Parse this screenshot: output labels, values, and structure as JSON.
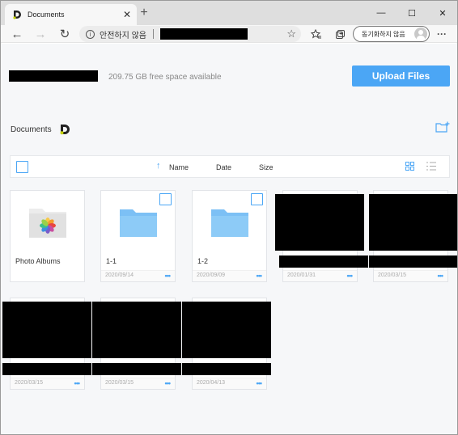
{
  "browser": {
    "tab_title": "Documents",
    "tab_close": "✕",
    "new_tab": "+",
    "security_label": "안전하지 않음",
    "sync_label": "동기화하지 않음",
    "more_label": "···",
    "minimize": "—",
    "maximize": "☐",
    "close": "✕"
  },
  "page": {
    "storage_free": "209.75 GB free space available",
    "upload_button": "Upload Files",
    "breadcrumb": "Documents",
    "accent_color": "#4ba6f5"
  },
  "toolbar": {
    "columns": {
      "name": "Name",
      "date": "Date",
      "size": "Size"
    },
    "sort_indicator": "↑"
  },
  "items": [
    {
      "name": "Photo Albums",
      "date": "",
      "type": "photo-albums"
    },
    {
      "name": "1-1",
      "date": "2020/09/14",
      "type": "folder"
    },
    {
      "name": "1-2",
      "date": "2020/09/09",
      "type": "folder"
    },
    {
      "name": "",
      "date": "2020/01/31",
      "type": "redacted"
    },
    {
      "name": "",
      "date": "2020/03/15",
      "type": "redacted"
    },
    {
      "name": "",
      "date": "2020/03/15",
      "type": "redacted"
    },
    {
      "name": "",
      "date": "2020/03/15",
      "type": "redacted"
    },
    {
      "name": "",
      "date": "2020/04/13",
      "type": "redacted"
    }
  ],
  "more_dots": "•••"
}
